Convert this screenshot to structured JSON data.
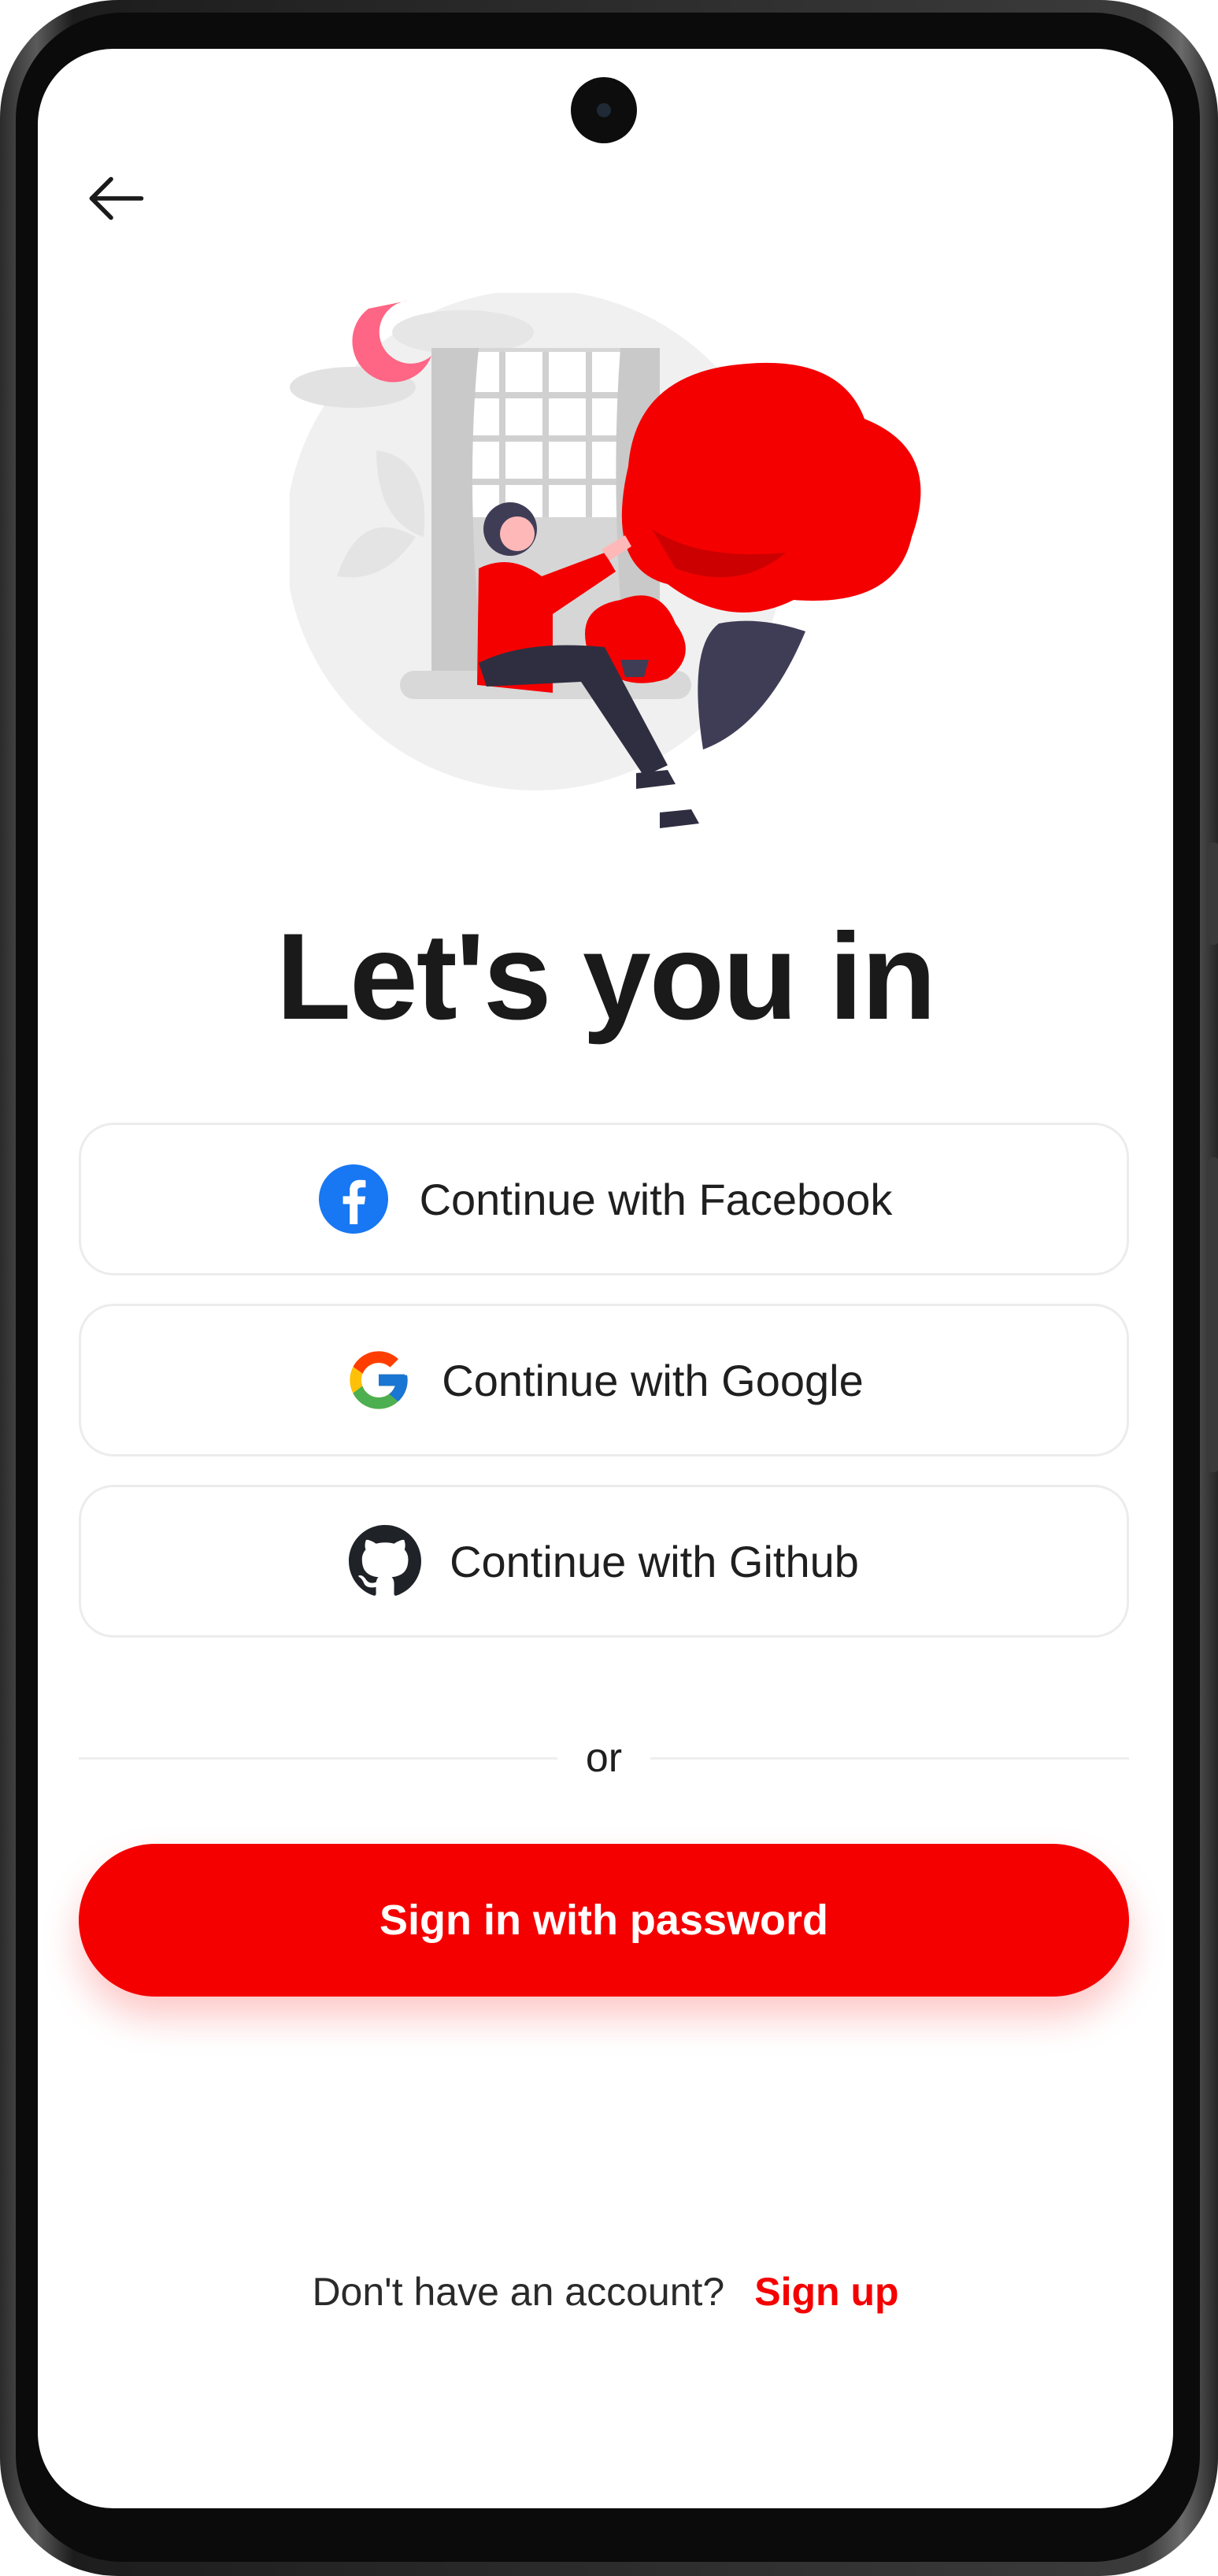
{
  "header": {
    "back_icon": "arrow-left-icon"
  },
  "title": "Let's you in",
  "social": [
    {
      "label": "Continue with Facebook",
      "icon": "facebook-icon",
      "color": "#1877F2"
    },
    {
      "label": "Continue with Google",
      "icon": "google-icon"
    },
    {
      "label": "Continue with Github",
      "icon": "github-icon",
      "color": "#1f2328"
    }
  ],
  "divider": {
    "text": "or"
  },
  "primary": {
    "label": "Sign in with password",
    "color": "#F50000"
  },
  "footer": {
    "prompt": "Don't have an account?",
    "link": "Sign up"
  },
  "illustration": {
    "accent": "#F50000",
    "dark": "#3f3d56",
    "sun": "#ff6584"
  }
}
